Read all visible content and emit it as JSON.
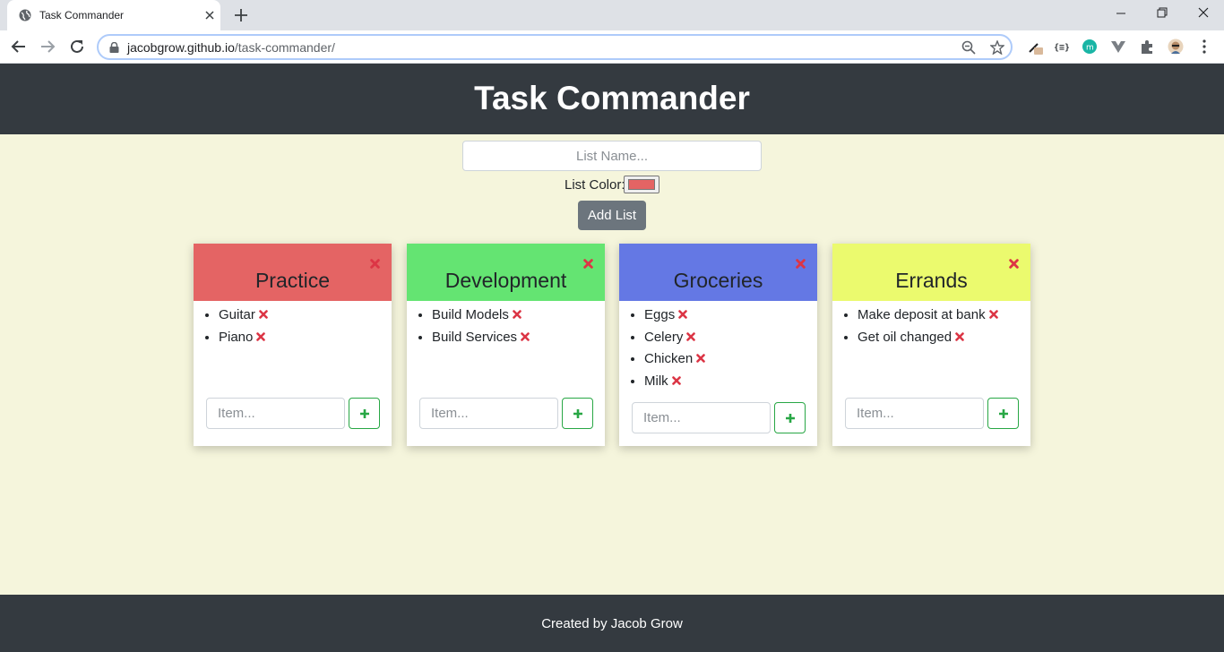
{
  "browser": {
    "tab_title": "Task Commander",
    "url_host": "jacobgrow.github.io",
    "url_path": "/task-commander/"
  },
  "header": {
    "title": "Task Commander"
  },
  "form": {
    "list_name_placeholder": "List Name...",
    "color_label": "List Color:",
    "color_value": "#e46464",
    "add_button": "Add List"
  },
  "lists": [
    {
      "title": "Practice",
      "color": "#e46464",
      "items": [
        "Guitar",
        "Piano"
      ],
      "item_placeholder": "Item..."
    },
    {
      "title": "Development",
      "color": "#64e472",
      "items": [
        "Build Models",
        "Build Services"
      ],
      "item_placeholder": "Item..."
    },
    {
      "title": "Groceries",
      "color": "#6478e4",
      "items": [
        "Eggs",
        "Celery",
        "Chicken",
        "Milk"
      ],
      "item_placeholder": "Item..."
    },
    {
      "title": "Errands",
      "color": "#ebfa6e",
      "items": [
        "Make deposit at bank",
        "Get oil changed"
      ],
      "item_placeholder": "Item..."
    }
  ],
  "footer": {
    "text": "Created by Jacob Grow"
  },
  "colors": {
    "page_bg": "#f5f5dc",
    "header_bg": "#343a40",
    "delete_red": "#dc3545",
    "add_green": "#28a745",
    "add_list_btn": "#6c757d"
  }
}
